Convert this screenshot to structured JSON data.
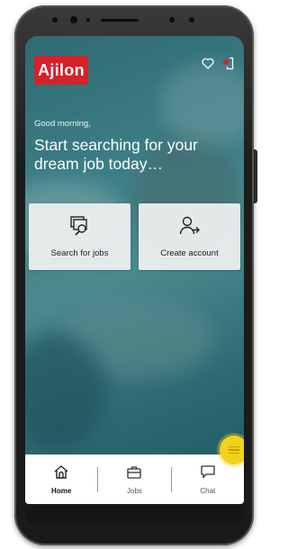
{
  "brand": {
    "logo_text": "Ajilon",
    "color": "#d6202a"
  },
  "header": {
    "icons": [
      "heart-icon",
      "notification-icon"
    ]
  },
  "hero": {
    "greeting": "Good morning,",
    "headline": "Start searching for your dream job today…"
  },
  "actions": {
    "search_jobs": {
      "label": "Search for jobs",
      "icon": "search-icon"
    },
    "create_account": {
      "label": "Create account",
      "icon": "add-user-icon"
    }
  },
  "bottom_nav": {
    "items": [
      {
        "label": "Home",
        "icon": "home-icon",
        "active": true
      },
      {
        "label": "Jobs",
        "icon": "briefcase-icon",
        "active": false
      },
      {
        "label": "Chat",
        "icon": "chat-icon",
        "active": false
      }
    ]
  },
  "fab": {
    "icon": "menu-icon",
    "color": "#f2d21a"
  }
}
